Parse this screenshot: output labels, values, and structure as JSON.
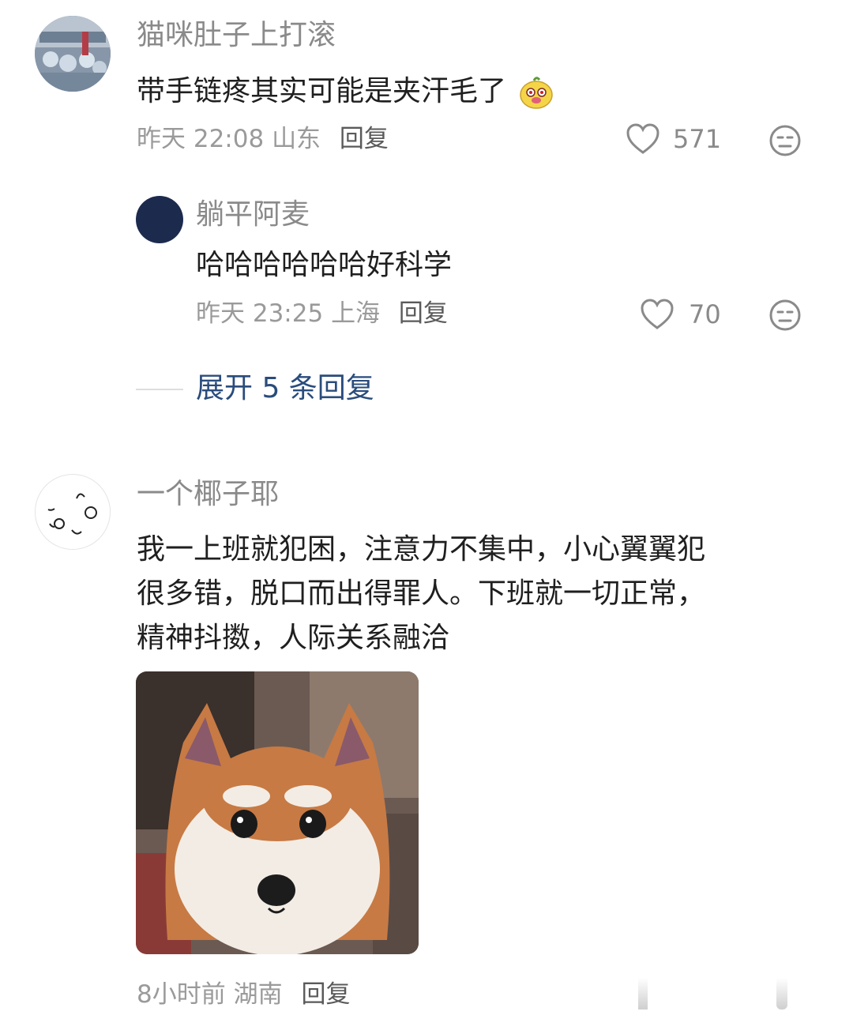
{
  "comments": [
    {
      "username": "猫咪肚子上打滚",
      "text": "带手链疼其实可能是夹汗毛了",
      "time": "昨天 22:08",
      "location": "山东",
      "reply_label": "回复",
      "likes": "571",
      "sticker_icon": "smiling-mascot-emoji-icon",
      "replies": [
        {
          "username": "躺平阿麦",
          "text": "哈哈哈哈哈哈好科学",
          "time": "昨天 23:25",
          "location": "上海",
          "reply_label": "回复",
          "likes": "70"
        }
      ],
      "expand_label": "展开 5 条回复"
    },
    {
      "username": "一个椰子耶",
      "text_lines": [
        "我一上班就犯困，注意力不集中，小心翼翼犯",
        "很多错，脱口而出得罪人。下班就一切正常，",
        "精神抖擞，人际关系融洽"
      ],
      "image_icon": "shiba-dog-photo",
      "time": "8小时前",
      "location": "湖南",
      "reply_label": "回复"
    }
  ],
  "colors": {
    "username": "#8a8a8a",
    "body_text": "#1f1f1f",
    "meta": "#9a9a9a",
    "expand_link": "#2a4c7c",
    "dark_avatar": "#1c2a4e"
  }
}
